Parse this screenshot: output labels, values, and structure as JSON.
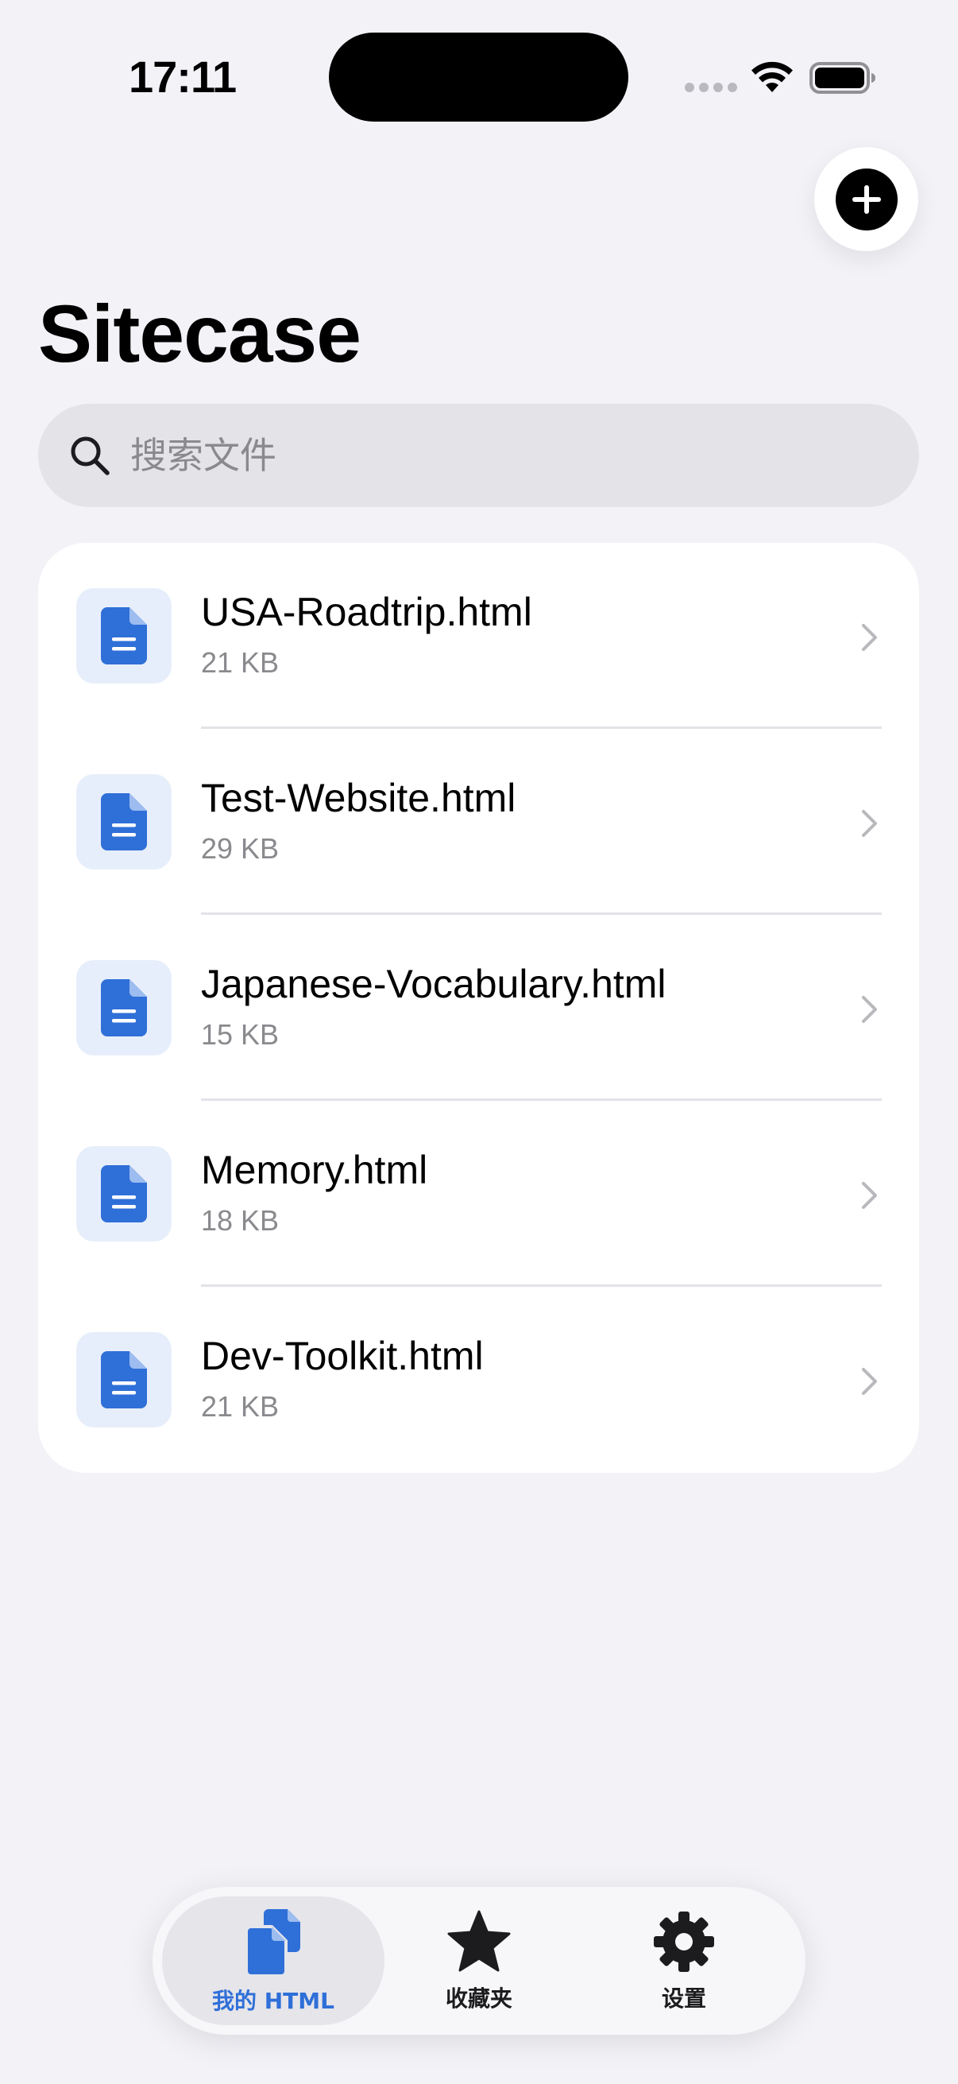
{
  "status_bar": {
    "time": "17:11"
  },
  "header": {
    "title": "Sitecase",
    "add_icon": "plus-circle-icon"
  },
  "search": {
    "placeholder": "搜索文件",
    "value": "",
    "icon": "search-icon"
  },
  "files": [
    {
      "name": "USA-Roadtrip.html",
      "size": "21 KB"
    },
    {
      "name": "Test-Website.html",
      "size": "29 KB"
    },
    {
      "name": "Japanese-Vocabulary.html",
      "size": "15 KB"
    },
    {
      "name": "Memory.html",
      "size": "18 KB"
    },
    {
      "name": "Dev-Toolkit.html",
      "size": "21 KB"
    }
  ],
  "tabs": [
    {
      "label": "我的 HTML",
      "icon": "documents-icon",
      "active": true
    },
    {
      "label": "收藏夹",
      "icon": "star-icon",
      "active": false
    },
    {
      "label": "设置",
      "icon": "gear-icon",
      "active": false
    }
  ],
  "colors": {
    "accent": "#2f6fd8",
    "background": "#f2f2f7",
    "icon_tile": "#e7eefb"
  }
}
